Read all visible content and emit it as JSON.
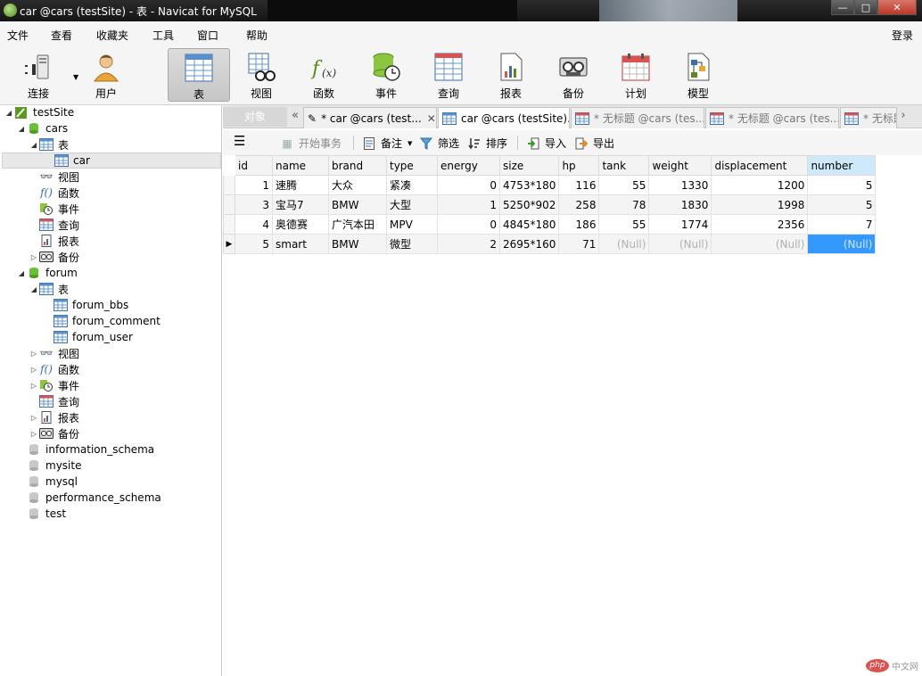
{
  "window": {
    "title": "car @cars (testSite) - 表 - Navicat for MySQL",
    "controls": {
      "minimize": "—",
      "maximize": "□",
      "close": "✕"
    }
  },
  "menu": {
    "items": [
      "文件",
      "查看",
      "收藏夹",
      "工具",
      "窗口",
      "帮助"
    ],
    "login": "登录"
  },
  "toolbar": {
    "tools": [
      {
        "label": "连接",
        "icon": "connection-icon"
      },
      {
        "label": "用户",
        "icon": "user-icon"
      },
      {
        "label": "表",
        "icon": "table-icon",
        "active": true
      },
      {
        "label": "视图",
        "icon": "view-icon"
      },
      {
        "label": "函数",
        "icon": "function-icon"
      },
      {
        "label": "事件",
        "icon": "event-icon"
      },
      {
        "label": "查询",
        "icon": "query-icon"
      },
      {
        "label": "报表",
        "icon": "report-icon"
      },
      {
        "label": "备份",
        "icon": "backup-icon"
      },
      {
        "label": "计划",
        "icon": "schedule-icon"
      },
      {
        "label": "模型",
        "icon": "model-icon"
      }
    ]
  },
  "sidebar": {
    "connection": "testSite",
    "db_cars": {
      "name": "cars",
      "tables_group": "表",
      "table_car": "car",
      "views": "视图",
      "functions": "函数",
      "events": "事件",
      "queries": "查询",
      "reports": "报表",
      "backups": "备份"
    },
    "db_forum": {
      "name": "forum",
      "tables_group": "表",
      "tables": [
        "forum_bbs",
        "forum_comment",
        "forum_user"
      ],
      "views": "视图",
      "functions": "函数",
      "events": "事件",
      "queries": "查询",
      "reports": "报表",
      "backups": "备份"
    },
    "other_dbs": [
      "information_schema",
      "mysite",
      "mysql",
      "performance_schema",
      "test"
    ]
  },
  "tabs": {
    "objects": "对象",
    "items": [
      {
        "label": "* car @cars (test...",
        "close": "✕",
        "icon": "table-design-icon"
      },
      {
        "label": "car @cars (testSite)...",
        "icon": "table-icon",
        "active": true
      },
      {
        "label": "* 无标题 @cars (tes...",
        "icon": "query-icon"
      },
      {
        "label": "* 无标题 @cars (tes...",
        "icon": "query-icon"
      },
      {
        "label": "* 无标题",
        "icon": "query-icon"
      }
    ]
  },
  "subtoolbar": {
    "menu": "☰",
    "begin_transaction": "开始事务",
    "memo": "备注",
    "filter": "筛选",
    "sort": "排序",
    "import": "导入",
    "export": "导出"
  },
  "grid": {
    "columns": [
      "id",
      "name",
      "brand",
      "type",
      "energy",
      "size",
      "hp",
      "tank",
      "weight",
      "displacement",
      "number"
    ],
    "rows": [
      [
        "1",
        "速腾",
        "大众",
        "紧凑",
        "0",
        "4753*180",
        "116",
        "55",
        "1330",
        "1200",
        "5"
      ],
      [
        "3",
        "宝马7",
        "BMW",
        "大型",
        "1",
        "5250*902",
        "258",
        "78",
        "1830",
        "1998",
        "5"
      ],
      [
        "4",
        "奥德赛",
        "广汽本田",
        "MPV",
        "0",
        "4845*180",
        "186",
        "55",
        "1774",
        "2356",
        "7"
      ],
      [
        "5",
        "smart",
        "BMW",
        "微型",
        "2",
        "2695*160",
        "71",
        "(Null)",
        "(Null)",
        "(Null)",
        "(Null)"
      ]
    ],
    "current_row_marker": "▶"
  },
  "watermark": {
    "logo": "php",
    "text": "中文网"
  }
}
